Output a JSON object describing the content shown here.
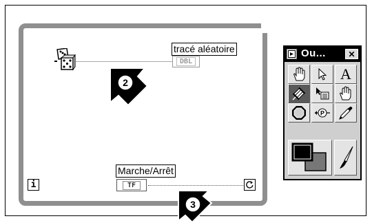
{
  "diagram": {
    "trace_label": "tracé aléatoire",
    "switch_label": "Marche/Arrêt",
    "dbl_terminal": "DBL",
    "tf_terminal": "TF",
    "iteration_terminal": "i",
    "callouts": [
      "2",
      "3"
    ]
  },
  "palette": {
    "title": "Ou...",
    "close_glyph": "✕",
    "tools": [
      "operate-value-tool",
      "position-size-select-tool",
      "edit-text-tool",
      "connect-wire-tool",
      "object-shortcut-menu-tool",
      "scroll-window-tool",
      "set-clear-breakpoint-tool",
      "probe-data-tool",
      "get-color-tool",
      "set-color-tool",
      "paintbrush-tool"
    ],
    "text_tool_glyph": "A"
  }
}
